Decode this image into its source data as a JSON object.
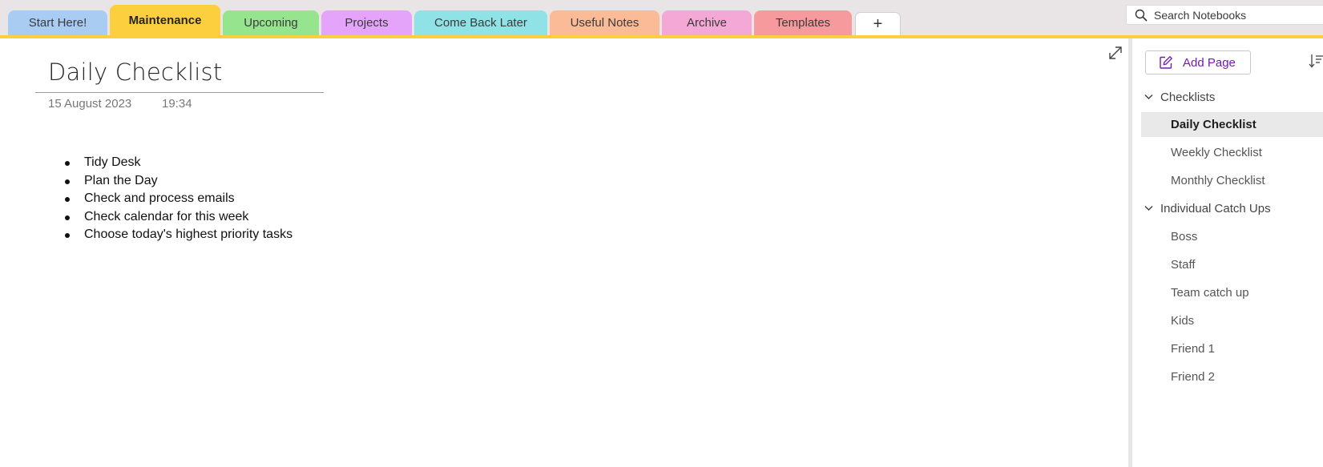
{
  "tabs": [
    {
      "label": "Start Here!",
      "color": "#a9ccf2",
      "active": false
    },
    {
      "label": "Maintenance",
      "color": "#fccf3f",
      "active": true
    },
    {
      "label": "Upcoming",
      "color": "#96e48e",
      "active": false
    },
    {
      "label": "Projects",
      "color": "#e3a4fa",
      "active": false
    },
    {
      "label": "Come Back Later",
      "color": "#8fe2e6",
      "active": false
    },
    {
      "label": "Useful Notes",
      "color": "#fcbb97",
      "active": false
    },
    {
      "label": "Archive",
      "color": "#f3a8d6",
      "active": false
    },
    {
      "label": "Templates",
      "color": "#f79a9e",
      "active": false
    }
  ],
  "add_tab": {
    "label": "+"
  },
  "search": {
    "placeholder": "Search Notebooks",
    "icon": "search-icon"
  },
  "page": {
    "title": "Daily Checklist",
    "date": "15 August 2023",
    "time": "19:34",
    "items": [
      "Tidy Desk",
      "Plan the Day",
      "Check and process emails",
      "Check calendar for this week",
      "Choose today's highest priority tasks"
    ]
  },
  "pane": {
    "add_page_label": "Add Page",
    "accent_color": "#7719aa",
    "sections": [
      {
        "label": "Checklists",
        "expanded": true,
        "pages": [
          {
            "label": "Daily Checklist",
            "selected": true
          },
          {
            "label": "Weekly Checklist",
            "selected": false
          },
          {
            "label": "Monthly Checklist",
            "selected": false
          }
        ]
      },
      {
        "label": "Individual Catch Ups",
        "expanded": true,
        "pages": [
          {
            "label": "Boss",
            "selected": false
          },
          {
            "label": "Staff",
            "selected": false
          },
          {
            "label": "Team catch up",
            "selected": false
          },
          {
            "label": "Kids",
            "selected": false
          },
          {
            "label": "Friend 1",
            "selected": false
          },
          {
            "label": "Friend 2",
            "selected": false
          }
        ]
      }
    ]
  }
}
